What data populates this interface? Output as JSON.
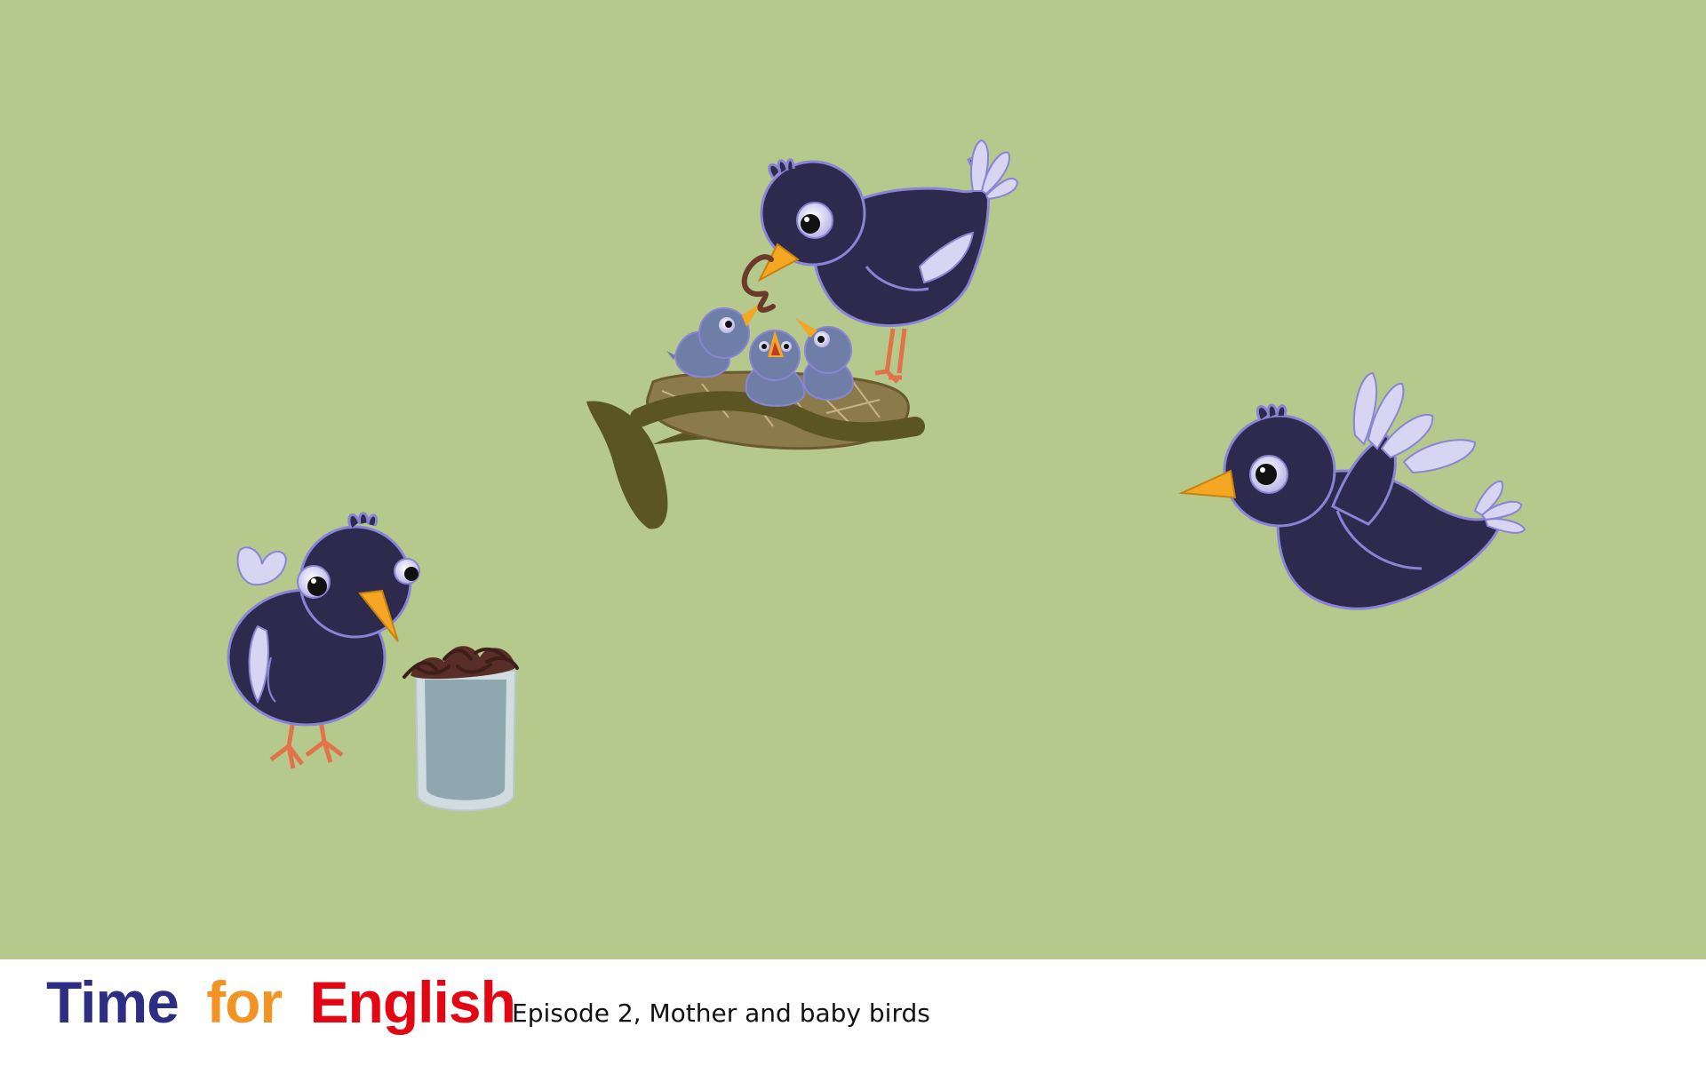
{
  "footer": {
    "brand": {
      "word1": "Time",
      "word2": "for",
      "word3": "English"
    },
    "subtitle": "Episode 2, Mother and baby birds"
  },
  "colors": {
    "background": "#b5c98c",
    "footer": "#ffffff",
    "brand_time": "#2d2e83",
    "brand_for": "#f39323",
    "brand_english": "#e30613",
    "bird_body": "#2e2a4e",
    "bird_outline": "#8a84d6",
    "baby_bird": "#6f7ea6",
    "beak": "#f5a623",
    "nest": "#8b7a4a",
    "branch": "#5a5523",
    "jar": "#8fa8b0"
  },
  "icons": [
    "mother-bird",
    "baby-bird",
    "flying-bird",
    "standing-bird",
    "nest",
    "branch",
    "worm-jar",
    "worm"
  ]
}
